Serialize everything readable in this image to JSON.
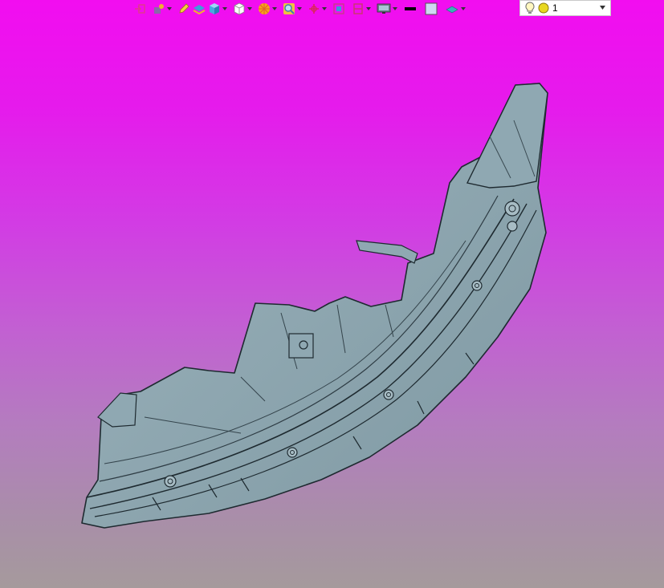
{
  "toolbar": {
    "icons": [
      "exit-sketch-icon",
      "measure-icon",
      "pencil-icon",
      "layer-icon",
      "cube-shaded-icon",
      "cube-wire-icon",
      "color-wheel-icon",
      "zoom-icon",
      "axis-icon",
      "fit-window-icon",
      "section-icon",
      "display-icon",
      "line-color-swatch",
      "fill-color-swatch",
      "plane-icon"
    ],
    "line_color": "#000000",
    "fill_color": "#cfd8f2"
  },
  "layer_selector": {
    "value": "1",
    "icons": [
      "lightbulb-icon",
      "sun-icon"
    ]
  },
  "viewport": {
    "background_top": "#f20df0",
    "background_bottom": "#a59a9c",
    "model_color": "#8fa9b3"
  }
}
